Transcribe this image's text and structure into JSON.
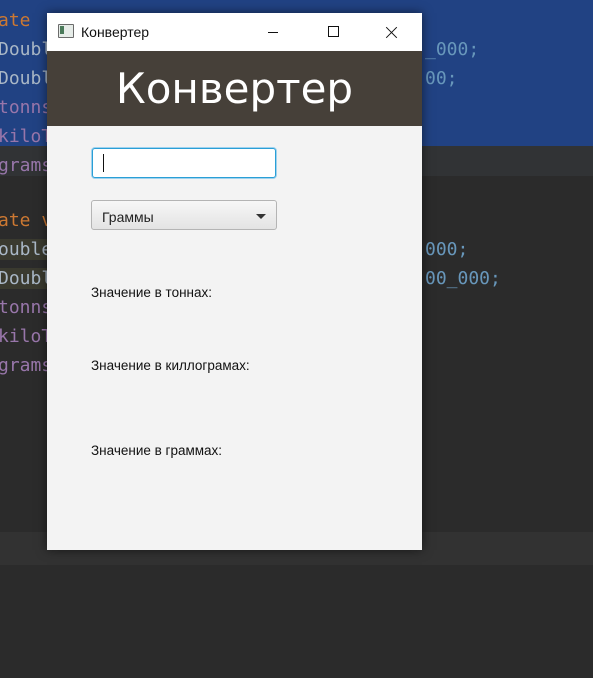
{
  "window": {
    "title": "Конвертер",
    "header_title": "Конвертер"
  },
  "input": {
    "value": ""
  },
  "unit_select": {
    "selected": "Граммы"
  },
  "results": {
    "tonnes_label": "Значение в тоннах:",
    "kilograms_label": "Значение в киллограмах:",
    "grams_label": "Значение в граммах:"
  },
  "ide": {
    "lines_a": [
      "ate",
      "Doubl",
      "Doubl",
      "tonns",
      "kiloT",
      "grams"
    ],
    "lines_b": [
      "ate v",
      "ouble",
      "Doubl",
      "tonns",
      "kiloT",
      "grams"
    ],
    "right_a": [
      "_000;",
      "00;"
    ],
    "right_b": [
      "000;",
      "00_000;"
    ]
  },
  "colors": {
    "header_bg": "#464039",
    "window_bg": "#f3f3f3",
    "focus_border": "#2a9fd6",
    "ide_selection": "#214283",
    "ide_bg": "#2b2b2b"
  }
}
